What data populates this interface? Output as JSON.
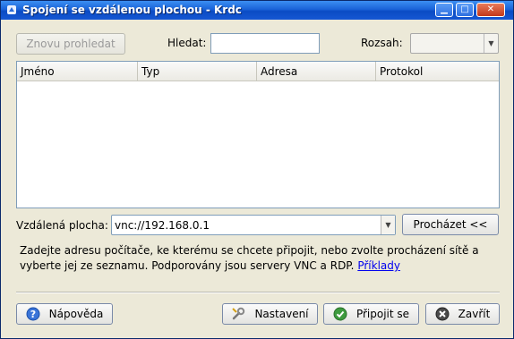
{
  "window": {
    "title": "Spojení se vzdálenou plochou - Krdc"
  },
  "toolbar": {
    "refresh_label": "Znovu prohledat",
    "search_label": "Hledat:",
    "search_value": "",
    "scope_label": "Rozsah:",
    "scope_value": ""
  },
  "table": {
    "columns": [
      "Jméno",
      "Typ",
      "Adresa",
      "Protokol"
    ],
    "rows": []
  },
  "remote": {
    "label": "Vzdálená plocha:",
    "value": "vnc://192.168.0.1",
    "browse_label": "Procházet <<"
  },
  "hint": {
    "line1": "Zadejte adresu počítače, ke kterému se chcete připojit, nebo zvolte procházení sítě a",
    "line2": "vyberte jej ze seznamu. Podporovány jsou servery VNC a RDP.",
    "link": "Příklady"
  },
  "footer": {
    "help_label": "Nápověda",
    "settings_label": "Nastavení",
    "connect_label": "Připojit se",
    "close_label": "Zavřít"
  },
  "colors": {
    "titlebar": "#1a63d8",
    "background": "#ece9d8",
    "link": "#0000ee"
  },
  "icons": [
    "app-icon",
    "help-icon",
    "wrench-icon",
    "check-icon",
    "close-icon"
  ]
}
